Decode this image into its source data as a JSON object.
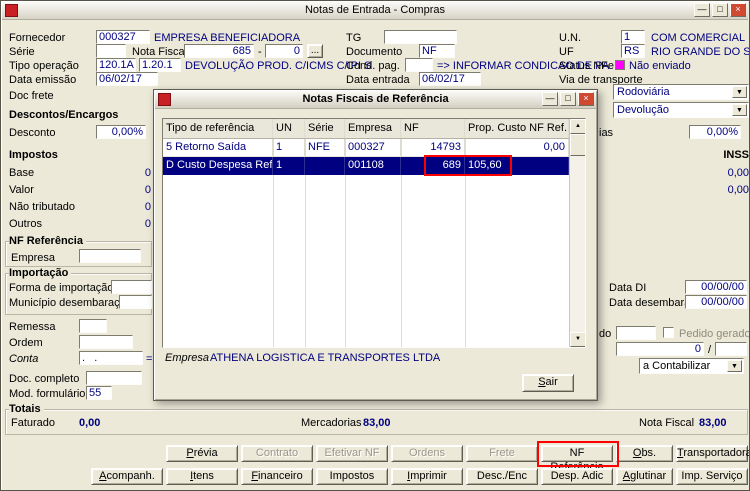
{
  "icons": {
    "minimize": "—",
    "maximize": "□",
    "close": "×",
    "dropdown": "▼",
    "scroll_up": "▲",
    "scroll_down": "▼",
    "browse": "..."
  },
  "colors": {
    "value_navy": "#000080",
    "selection_bg": "#000080",
    "annotation_red": "#ff0000",
    "nfe_status_magenta": "#ff00ff"
  },
  "main": {
    "title": "Notas de Entrada - Compras",
    "fornecedor_label": "Fornecedor",
    "fornecedor_code": "000327",
    "fornecedor_name": "EMPRESA BENEFICIADORA",
    "tg_label": "TG",
    "un_label": "U.N.",
    "un_code": "1",
    "un_name": "COM COMERCIAL",
    "serie_label": "Série",
    "nota_fiscal_label": "Nota Fiscal",
    "nota_fiscal_value": "685",
    "dash": "-",
    "nota_fiscal_sub": "0",
    "documento_label": "Documento",
    "documento_value": "NF",
    "uf_label": "UF",
    "uf_code": "RS",
    "uf_name": "RIO GRANDE DO SUL",
    "tipo_operacao_label": "Tipo operação",
    "tipo_operacao_code1": "120.1A",
    "tipo_operacao_code2": "1.20.1",
    "tipo_operacao_desc": "DEVOLUÇÃO PROD. C/ICMS C/IPI S",
    "cond_pag_label": "Cond. pag.",
    "cond_pag_hint": "=> INFORMAR CONDICAO DE PA",
    "status_nfe_label": "Status NFe",
    "status_nfe_value": "Não enviado",
    "data_emissao_label": "Data emissão",
    "data_emissao_value": "06/02/17",
    "data_entrada_label": "Data entrada",
    "data_entrada_value": "06/02/17",
    "via_transporte_label": "Via de transporte",
    "via_transporte_value": "Rodoviária",
    "doc_frete_label": "Doc frete",
    "tipo_nota_value": "Devolução",
    "descontos_section": "Descontos/Encargos",
    "desconto_label": "Desconto",
    "desconto_value": "0,00%",
    "acessorias_label_cut": "ias",
    "acessorias_value": "0,00%",
    "impostos_section": "Impostos",
    "base_label": "Base",
    "valor_label": "Valor",
    "nao_tributado_label": "Não tributado",
    "outros_label": "Outros",
    "base_value": "0",
    "valor_value": "0",
    "nao_tributado_value": "0",
    "outros_value": "0",
    "inss_label": "INSS",
    "inss_base_value": "0,00",
    "inss_valor_value": "0,00",
    "nf_ref_section": "NF Referência",
    "nf_ref_empresa_label": "Empresa",
    "importacao_section": "Importação",
    "forma_importacao_label": "Forma de importação",
    "municipio_label": "Município desembaraço",
    "data_di_label": "Data DI",
    "data_di_value": "00/00/00",
    "data_desembaraco_label": "Data desembaraço",
    "data_desembaraco_value": "00/00/00",
    "remessa_label": "Remessa",
    "ordem_label": "Ordem",
    "conta_label": "Conta",
    "conta_value": ".   .",
    "conta_hint": "=> I",
    "pedido_label_cut": "do",
    "pedido_gerado_label": "Pedido gerado",
    "pedido_num_value": "0",
    "slash": "/",
    "contabilizar_value": "a Contabilizar",
    "doc_completo_label": "Doc. completo",
    "mod_formulario_label": "Mod. formulário",
    "mod_formulario_value": "55",
    "totais_section": "Totais",
    "faturado_label": "Faturado",
    "faturado_value": "0,00",
    "mercadorias_label": "Mercadorias",
    "mercadorias_value": "83,00",
    "nota_fiscal_total_label": "Nota Fiscal",
    "nota_fiscal_total_value": "83,00",
    "buttons_row1": [
      "Prévia",
      "Contrato",
      "Efetivar NF",
      "Ordens",
      "Frete",
      "NF Referência",
      "Obs.",
      "Transportadora"
    ],
    "buttons_row2": [
      "Acompanh.",
      "Itens",
      "Financeiro",
      "Impostos",
      "Imprimir",
      "Desc./Enc",
      "Desp. Adic",
      "Aglutinar",
      "Imp. Serviço"
    ]
  },
  "modal": {
    "title": "Notas Fiscais de Referência",
    "columns": [
      "Tipo de referência",
      "UN",
      "Série",
      "Empresa",
      "NF",
      "Prop. Custo NF Ref."
    ],
    "rows": [
      {
        "tipo": "5 Retorno Saída",
        "un": "1",
        "serie": "NFE",
        "empresa": "000327",
        "nf": "14793",
        "prop": "0,00"
      },
      {
        "tipo": "D Custo Despesa Ref",
        "un": "1",
        "serie": "",
        "empresa": "001108",
        "nf": "689",
        "prop": "105,60"
      }
    ],
    "empresa_label": "Empresa",
    "empresa_value": "ATHENA LOGISTICA E TRANSPORTES LTDA",
    "sair_button": "Sair"
  }
}
